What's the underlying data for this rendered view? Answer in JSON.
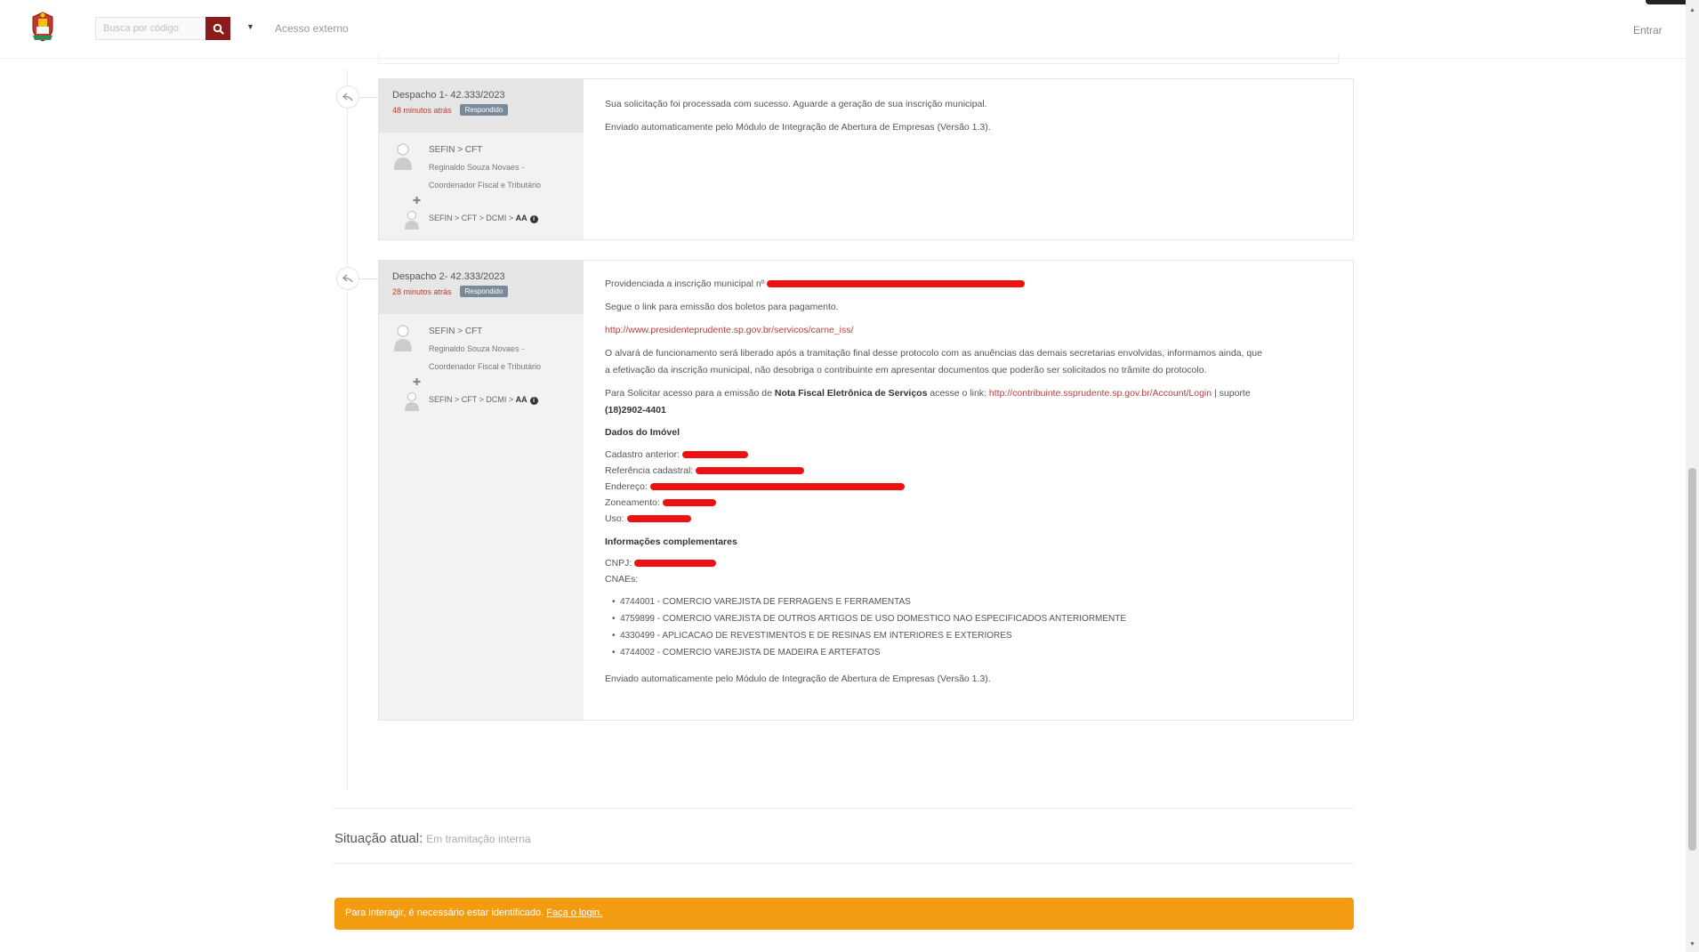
{
  "header": {
    "search_placeholder": "Busca por código",
    "external_access": "Acesso externo",
    "login": "Entrar"
  },
  "despachos": [
    {
      "title": "Despacho 1- 42.333/2023",
      "time_ago": "48 minutos atrás",
      "badge": "Respondido",
      "from_name": "SEFIN > CFT",
      "from_detail_1": "Reginaldo Souza Novaes -",
      "from_detail_2": "Coordenador Fiscal e Tributário",
      "to_prefix": "SEFIN > CFT > DCMI > ",
      "to_bold": "AA",
      "lines": [
        "Sua solicitação foi processada com sucesso. Aguarde a geração de sua inscrição municipal.",
        "Enviado automaticamente pelo Módulo de Integração de Abertura de Empresas (Versão 1.3)."
      ]
    },
    {
      "title": "Despacho 2- 42.333/2023",
      "time_ago": "28 minutos atrás",
      "badge": "Respondido",
      "from_name": "SEFIN > CFT",
      "from_detail_1": "Reginaldo Souza Novaes -",
      "from_detail_2": "Coordenador Fiscal e Tributário",
      "to_prefix": "SEFIN > CFT > DCMI > ",
      "to_bold": "AA",
      "provided": "Providenciada a inscrição municipal nº",
      "follow_link_text": "Segue o link para emissão dos boletos para pagamento.",
      "boletos_url": "http://www.presidenteprudente.sp.gov.br/servicos/carne_iss/",
      "alvara_1": "O alvará de funcionamento será liberado após a tramitação final desse protocolo com as anuências das demais secretarias envolvidas, informamos ainda, que",
      "alvara_2": "a efetivação da inscrição municipal, não desobriga o contribuinte em apresentar documentos que poderão ser solicitados no trâmite do protocolo.",
      "nf_prefix": "Para Solicitar acesso para a emissão de ",
      "nf_bold": "Nota Fiscal Eletrônica de Serviços",
      "nf_mid": " acesse o link: ",
      "nf_url": "http://contribuinte.ssprudente.sp.gov.br/Account/Login",
      "nf_suffix": " | suporte",
      "nf_phone": "(18)2902-4401",
      "dados_imovel": "Dados do Imóvel",
      "cadastro_anterior": "Cadastro anterior:",
      "referencia_cadastral": "Referência cadastral:",
      "endereco": "Endereço:",
      "zoneamento": "Zoneamento:",
      "uso": "Uso:",
      "info_comp": "Informações complementares",
      "cnpj": "CNPJ:",
      "cnaes": "CNAEs:",
      "cnae_list": [
        "4744001 - COMERCIO VAREJISTA DE FERRAGENS E FERRAMENTAS",
        "4759899 - COMERCIO VAREJISTA DE OUTROS ARTIGOS DE USO DOMESTICO NAO ESPECIFICADOS ANTERIORMENTE",
        "4330499 - APLICACAO DE REVESTIMENTOS E DE RESINAS EM INTERIORES E EXTERIORES",
        "4744002 - COMERCIO VAREJISTA DE MADEIRA E ARTEFATOS"
      ],
      "footer": "Enviado automaticamente pelo Módulo de Integração de Abertura de Empresas (Versão 1.3)."
    }
  ],
  "situacao": {
    "label": "Situação atual:",
    "value": "Em tramitação interna"
  },
  "alert": {
    "text": "Para interagir, é necessário estar identificado.",
    "link": "Faça o login."
  },
  "colors": {
    "brand_red": "#8b1a1a",
    "alert_orange": "#f39c12",
    "redaction": "#e11111"
  }
}
